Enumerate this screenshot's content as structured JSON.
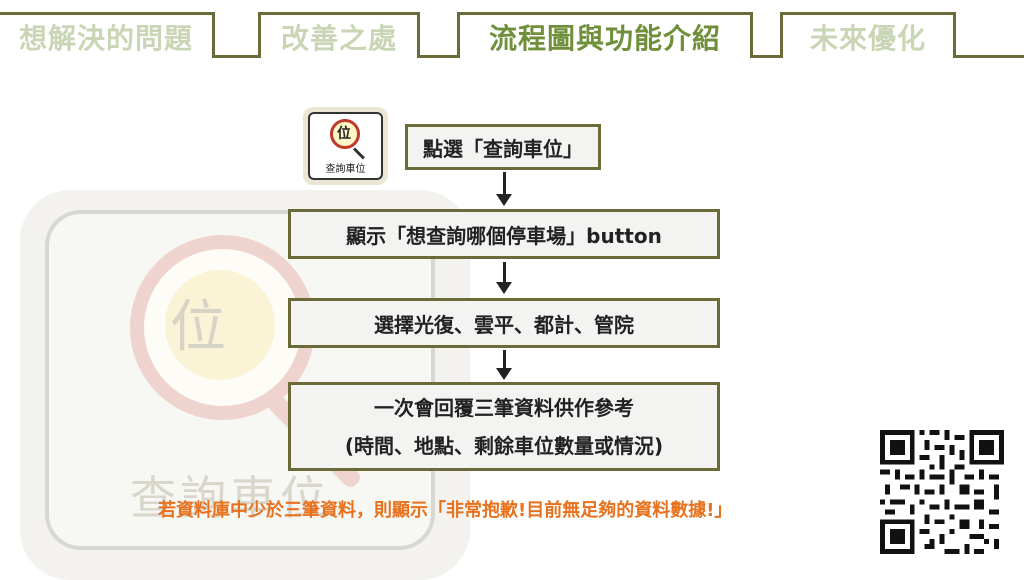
{
  "tabs": [
    {
      "label": "想解決的問題",
      "active": false
    },
    {
      "label": "改善之處",
      "active": false
    },
    {
      "label": "流程圖與功能介紹",
      "active": true
    },
    {
      "label": "未來優化",
      "active": false
    }
  ],
  "app_icon": {
    "char": "位",
    "label": "查詢車位"
  },
  "background_icon": {
    "char": "位",
    "label": "查詢車位"
  },
  "flow": {
    "step1": "點選「查詢車位」",
    "step2": "顯示「想查詢哪個停車場」button",
    "step3": "選擇光復、雲平、都計、管院",
    "step4_line1": "一次會回覆三筆資料供作參考",
    "step4_line2": "(時間、地點、剩餘車位數量或情況)"
  },
  "note": "若資料庫中少於三筆資料，則顯示「非常抱歉!目前無足夠的資料數據!」",
  "colors": {
    "accent": "#6b6b3a",
    "active_tab": "#6f8f3a",
    "inactive_tab": "#c9d6b5",
    "note": "#e8711d"
  },
  "qr_icon": "qr-code"
}
